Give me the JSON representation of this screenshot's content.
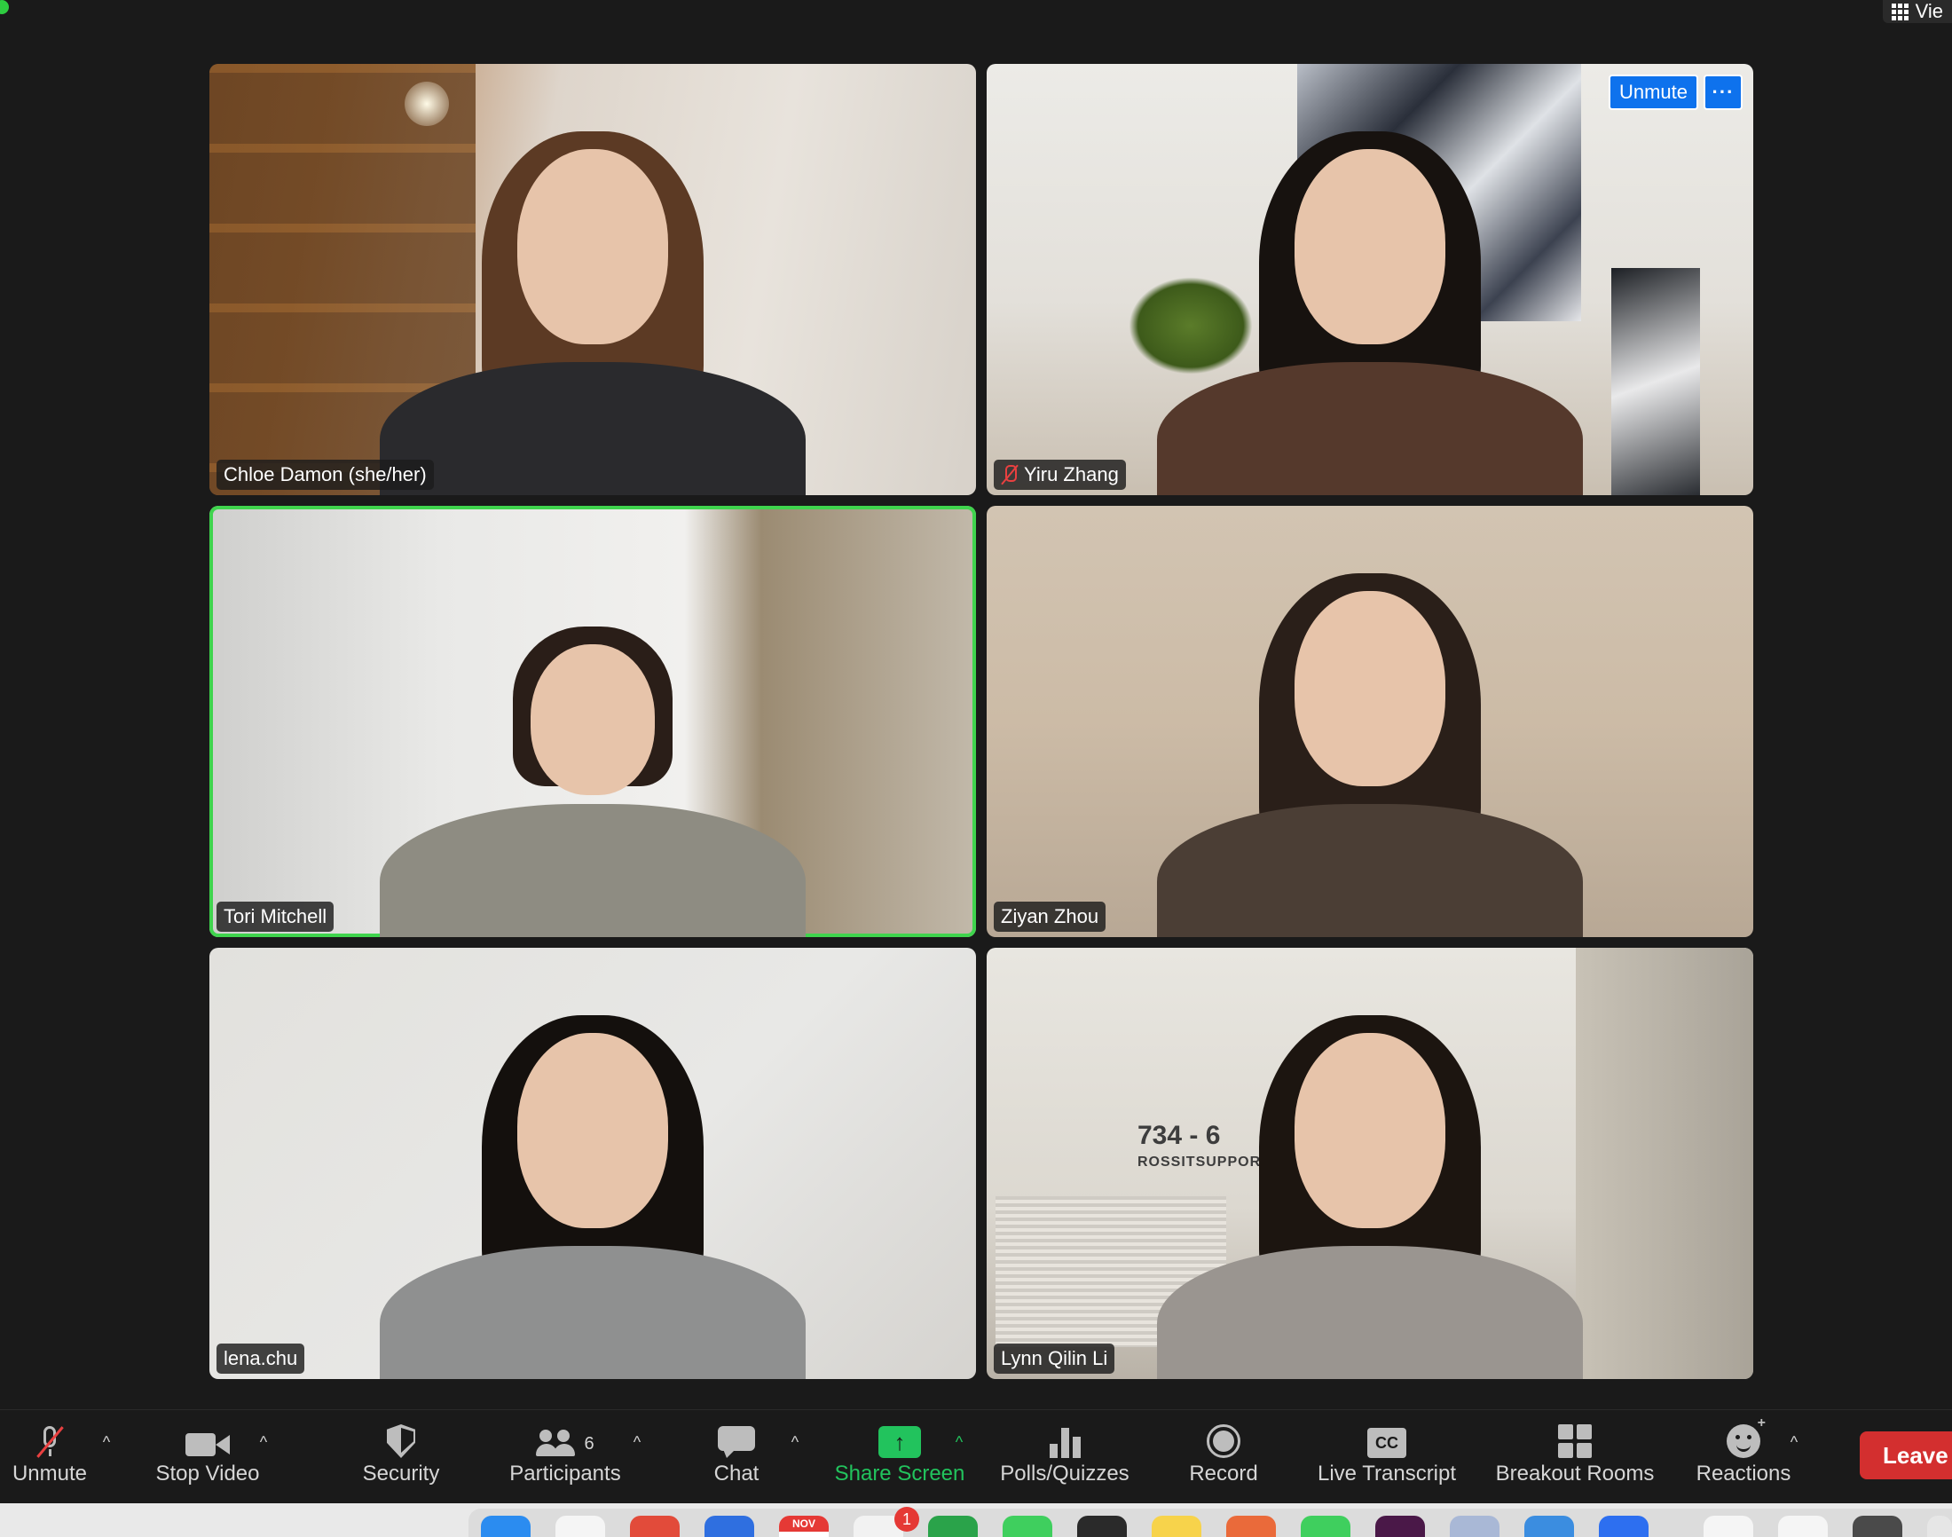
{
  "top": {
    "view_label": "Vie"
  },
  "tiles": [
    {
      "name": "Chloe Damon (she/her)",
      "muted": false,
      "active": false
    },
    {
      "name": "Yiru Zhang",
      "muted": true,
      "active": false
    },
    {
      "name": "Tori Mitchell",
      "muted": false,
      "active": true
    },
    {
      "name": "Ziyan Zhou",
      "muted": false,
      "active": false
    },
    {
      "name": "lena.chu",
      "muted": false,
      "active": false
    },
    {
      "name": "Lynn Qilin Li",
      "muted": false,
      "active": false
    }
  ],
  "tile_overlay": {
    "unmute_label": "Unmute",
    "more_label": "···"
  },
  "background_sign": {
    "number": "734 - 6",
    "text": "ROSSITSUPPORT"
  },
  "toolbar": {
    "unmute": "Unmute",
    "stop_video": "Stop Video",
    "security": "Security",
    "participants": "Participants",
    "participants_count": "6",
    "chat": "Chat",
    "share_screen": "Share Screen",
    "polls": "Polls/Quizzes",
    "record": "Record",
    "live_transcript": "Live Transcript",
    "cc_label": "CC",
    "breakout_rooms": "Breakout Rooms",
    "reactions": "Reactions",
    "leave": "Leave",
    "caret": "^",
    "share_arrow": "↑",
    "reactions_plus": "+"
  },
  "dock": {
    "calendar_month": "NOV",
    "notification_count": "1"
  },
  "colors": {
    "active_speaker": "#3fd44d",
    "share_green": "#22c35d",
    "unmute_blue": "#0e72ed",
    "leave_red": "#d32f2f",
    "muted_red": "#e94040"
  }
}
